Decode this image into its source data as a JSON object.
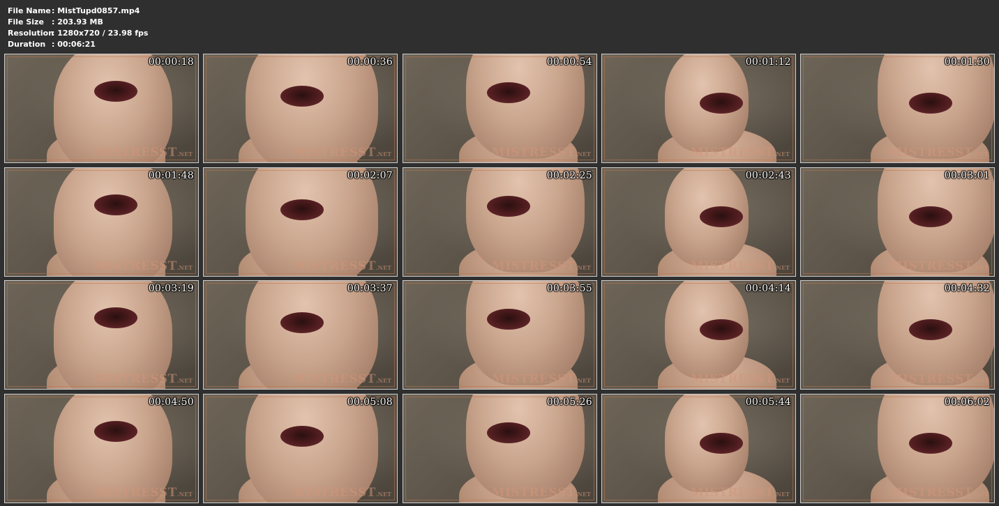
{
  "file_info": {
    "file_name_label": "File Name",
    "file_name_value": ": MistTupd0857.mp4",
    "file_size_label": "File Size",
    "file_size_value": ": 203.93 MB",
    "resolution_label": "Resolution",
    "resolution_value": ": 1280x720 / 23.98 fps",
    "duration_label": "Duration",
    "duration_value": ": 00:06:21"
  },
  "watermark": {
    "main": "MISTRESST",
    "suffix": ".NET"
  },
  "thumbnails": [
    {
      "timestamp": "00:00:18"
    },
    {
      "timestamp": "00:00:36"
    },
    {
      "timestamp": "00:00:54"
    },
    {
      "timestamp": "00:01:12"
    },
    {
      "timestamp": "00:01:30"
    },
    {
      "timestamp": "00:01:48"
    },
    {
      "timestamp": "00:02:07"
    },
    {
      "timestamp": "00:02:25"
    },
    {
      "timestamp": "00:02:43"
    },
    {
      "timestamp": "00:03:01"
    },
    {
      "timestamp": "00:03:19"
    },
    {
      "timestamp": "00:03:37"
    },
    {
      "timestamp": "00:03:55"
    },
    {
      "timestamp": "00:04:14"
    },
    {
      "timestamp": "00:04:32"
    },
    {
      "timestamp": "00:04:50"
    },
    {
      "timestamp": "00:05:08"
    },
    {
      "timestamp": "00:05:26"
    },
    {
      "timestamp": "00:05:44"
    },
    {
      "timestamp": "00:06:02"
    }
  ]
}
